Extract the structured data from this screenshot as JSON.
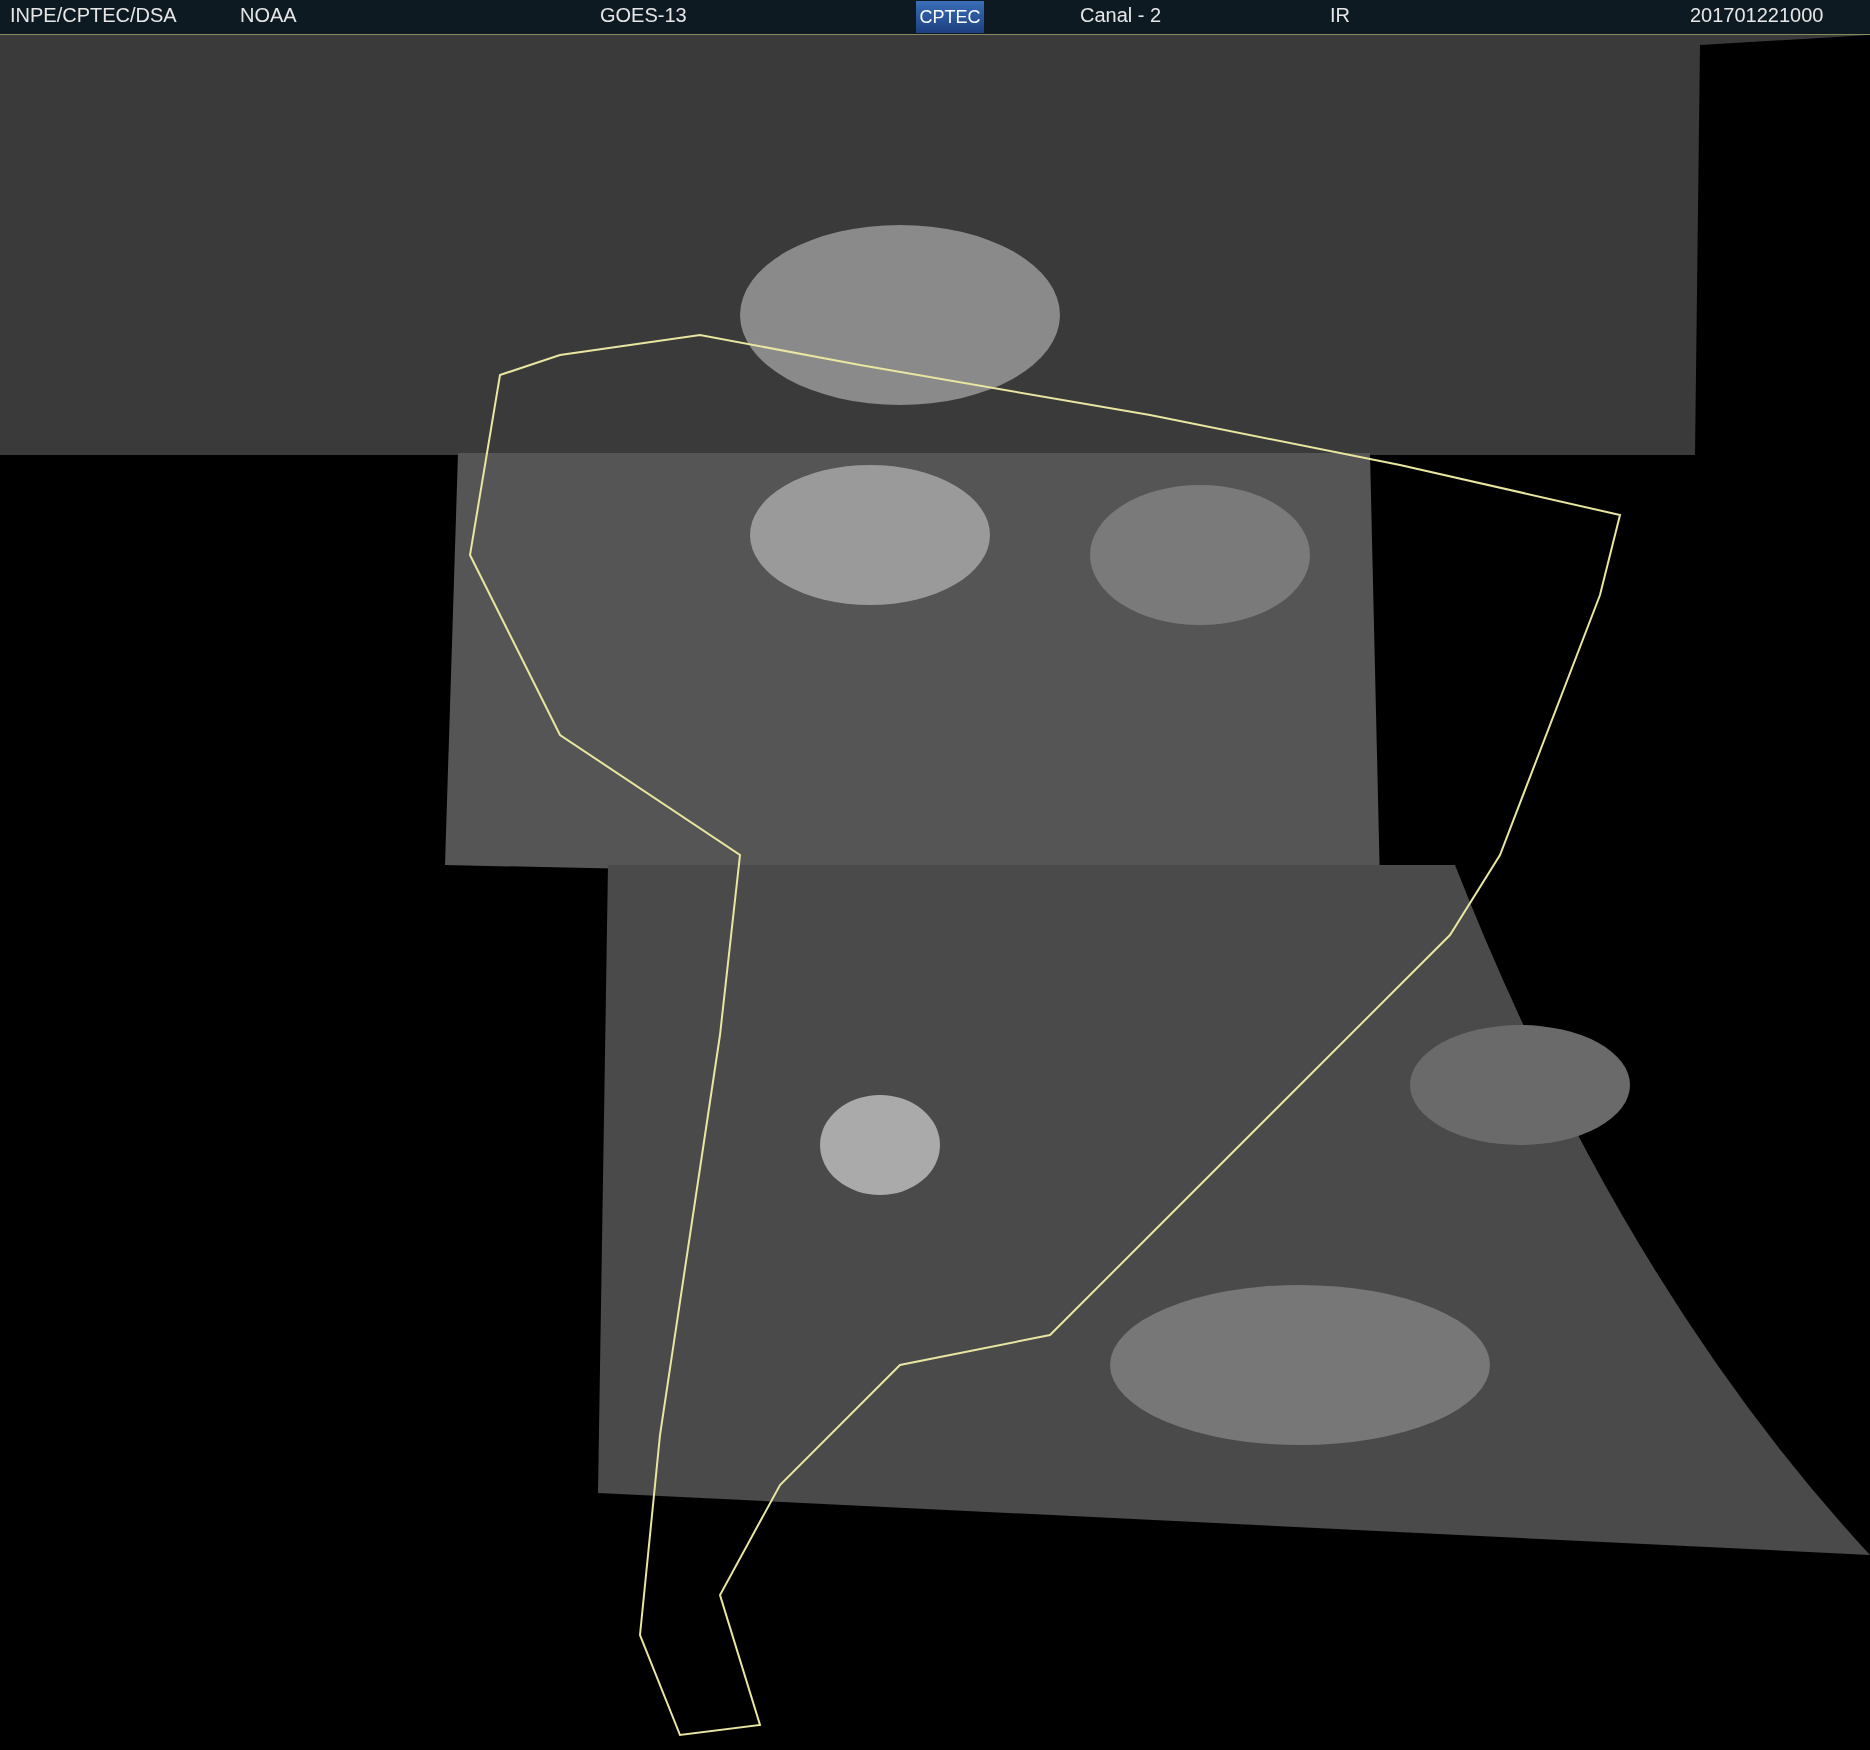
{
  "header": {
    "source": "INPE/CPTEC/DSA",
    "agency": "NOAA",
    "satellite": "GOES-13",
    "logo": "CPTEC",
    "channel": "Canal - 2",
    "band": "IR",
    "timestamp": "201701221000"
  }
}
